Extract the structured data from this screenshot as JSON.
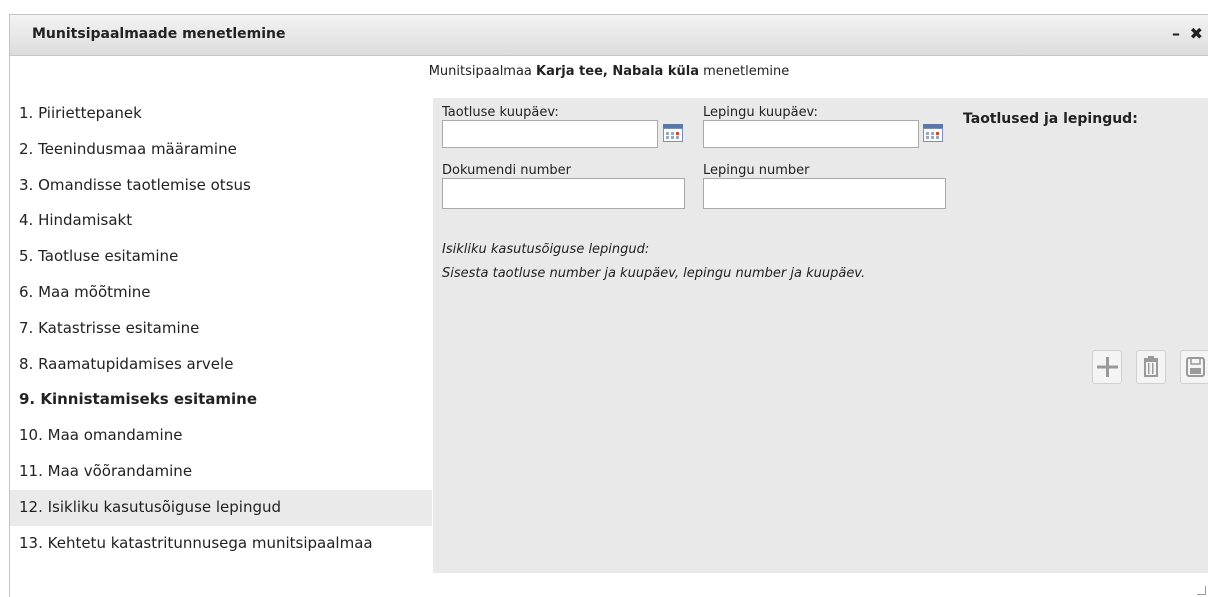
{
  "dialog": {
    "title": "Munitsipaalmaade menetlemine",
    "minimize_label": "–",
    "close_label": "✖"
  },
  "subtitle": {
    "prefix": "Munitsipaalmaa",
    "name": "Karja tee, Nabala küla",
    "suffix": "menetlemine"
  },
  "steps": [
    {
      "label": "1. Piiriettepanek"
    },
    {
      "label": "2. Teenindusmaa määramine"
    },
    {
      "label": "3. Omandisse taotlemise otsus"
    },
    {
      "label": "4. Hindamisakt"
    },
    {
      "label": "5. Taotluse esitamine"
    },
    {
      "label": "6. Maa mõõtmine"
    },
    {
      "label": "7. Katastrisse esitamine"
    },
    {
      "label": "8. Raamatupidamises arvele"
    },
    {
      "label": "9. Kinnistamiseks esitamine"
    },
    {
      "label": "10. Maa omandamine"
    },
    {
      "label": "11. Maa võõrandamine"
    },
    {
      "label": "12. Isikliku kasutusõiguse lepingud"
    },
    {
      "label": "13. Kehtetu katastritunnusega munitsipaalmaa"
    }
  ],
  "form": {
    "application_date_label": "Taotluse kuupäev:",
    "application_date_value": "",
    "contract_date_label": "Lepingu kuupäev:",
    "contract_date_value": "",
    "document_number_label": "Dokumendi number",
    "document_number_value": "",
    "contract_number_label": "Lepingu number",
    "contract_number_value": "",
    "section_title": "Isikliku kasutusõiguse lepingud:",
    "hint": "Sisesta taotluse number ja kuupäev, lepingu number ja kuupäev."
  },
  "side": {
    "title": "Taotlused ja lepingud:"
  },
  "icons": {
    "add": "plus-icon",
    "delete": "trash-icon",
    "save": "save-icon",
    "calendar": "calendar-icon"
  },
  "colors": {
    "panel": "#e9e9e9",
    "selected_step": "#eaeaea"
  }
}
